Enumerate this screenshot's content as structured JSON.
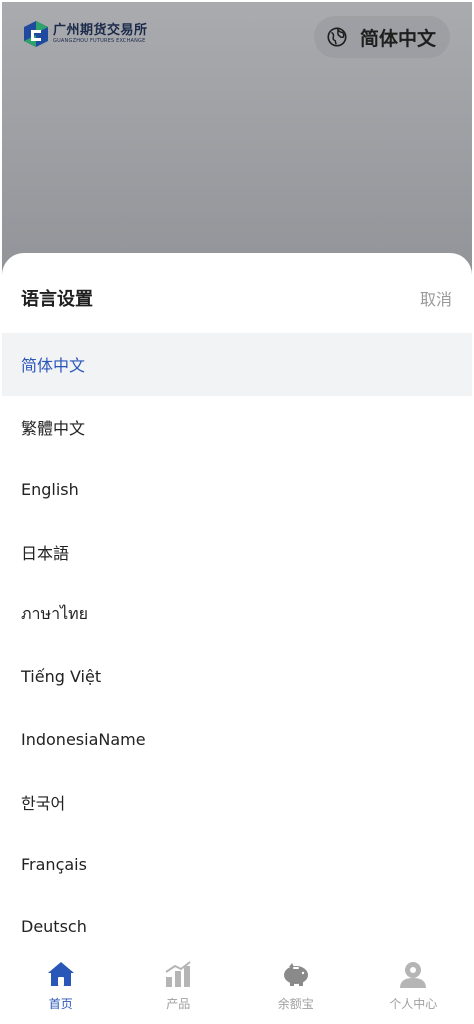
{
  "header": {
    "logo_cn": "广州期货交易所",
    "logo_en": "GUANGZHOU FUTURES EXCHANGE",
    "current_language": "简体中文"
  },
  "sheet": {
    "title": "语言设置",
    "cancel_label": "取消",
    "languages": [
      {
        "label": "简体中文",
        "selected": true
      },
      {
        "label": "繁體中文",
        "selected": false
      },
      {
        "label": "English",
        "selected": false
      },
      {
        "label": "日本語",
        "selected": false
      },
      {
        "label": "ภาษาไทย",
        "selected": false
      },
      {
        "label": "Tiếng Việt",
        "selected": false
      },
      {
        "label": "IndonesiaName",
        "selected": false
      },
      {
        "label": "한국어",
        "selected": false
      },
      {
        "label": "Français",
        "selected": false
      },
      {
        "label": "Deutsch",
        "selected": false
      }
    ]
  },
  "tabbar": {
    "tabs": [
      {
        "label": "首页",
        "icon": "home-icon",
        "active": true
      },
      {
        "label": "产品",
        "icon": "chart-icon",
        "active": false
      },
      {
        "label": "余额宝",
        "icon": "piggy-bank-icon",
        "active": false
      },
      {
        "label": "个人中心",
        "icon": "user-icon",
        "active": false
      }
    ]
  },
  "colors": {
    "accent": "#2a56b7",
    "selected_row_bg": "#f2f3f5",
    "muted_text": "#9a9a9a",
    "icon_gray": "#b5b5b5"
  }
}
